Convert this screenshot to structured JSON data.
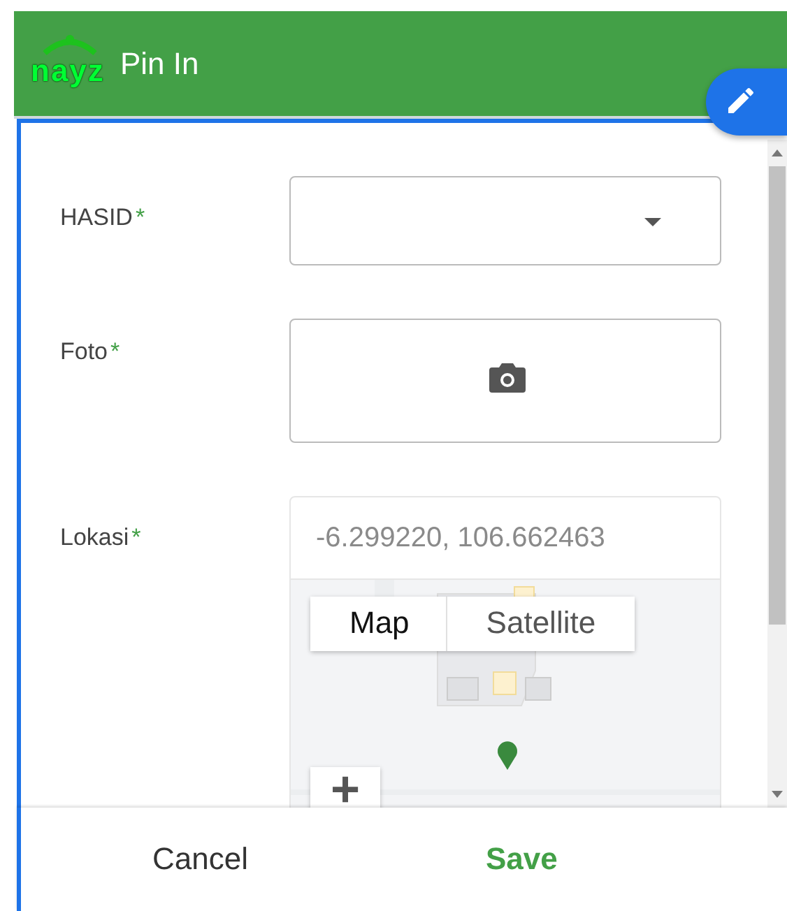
{
  "header": {
    "logo_text": "nayz",
    "title": "Pin In"
  },
  "fields": [
    {
      "kind": "select",
      "label": "HASID",
      "required_mark": "*"
    },
    {
      "label": "Foto",
      "required_mark": "*"
    },
    {
      "kind": "location",
      "label": "Lokasi",
      "required_mark": "*",
      "value": "-6.299220, 106.662463",
      "map": {
        "kind": "picture",
        "types": [
          {
            "label": "Map",
            "selected": true
          },
          {
            "label": "Satellite",
            "selected": false
          }
        ],
        "zoom_in": "+"
      }
    }
  ],
  "buttons": [
    {
      "kind": "cancel",
      "label": "Cancel"
    },
    {
      "kind": "save",
      "label": "Save"
    }
  ]
}
